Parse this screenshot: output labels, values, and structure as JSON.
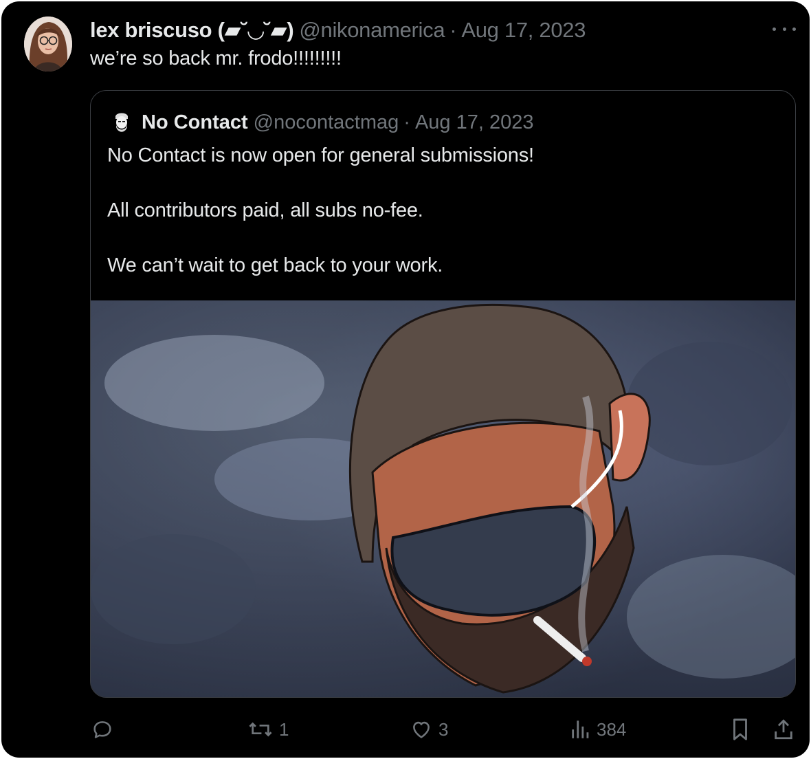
{
  "tweet": {
    "author_name": "lex briscuso (▰˘◡˘▰)",
    "author_handle": "@nikonamerica",
    "separator": "·",
    "date": "Aug 17, 2023",
    "text": "we’re so back mr. frodo!!!!!!!!!"
  },
  "quoted": {
    "author_name": "No Contact",
    "author_handle": "@nocontactmag",
    "separator": "·",
    "date": "Aug 17, 2023",
    "paragraphs": [
      "No Contact is now open for general submissions!",
      "All contributors paid, all subs no-fee.",
      "We can’t wait to get back to your work."
    ],
    "image_description_icon": "illustration-masked-man-smoking"
  },
  "actions": {
    "reply_count": "",
    "retweet_count": "1",
    "like_count": "3",
    "views_count": "384"
  },
  "colors": {
    "background": "#000000",
    "text_primary": "#e7e9ea",
    "text_secondary": "#71767b",
    "border": "#3a3d42"
  }
}
